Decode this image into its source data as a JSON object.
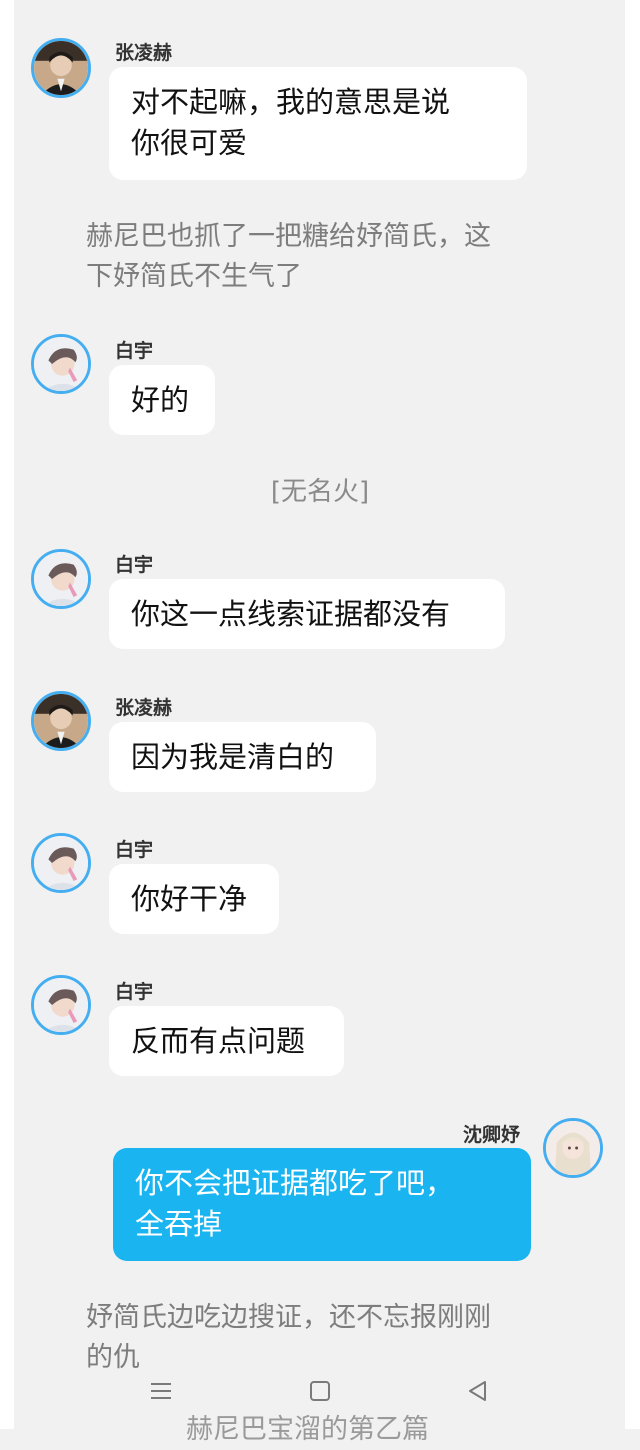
{
  "messages": [
    {
      "sender": "张凌赫",
      "lines": [
        "对不起嘛，我的意思是说",
        "你很可爱"
      ]
    },
    {
      "narration": [
        "赫尼巴也抓了一把糖给妤简氏，这",
        "下妤简氏不生气了"
      ]
    },
    {
      "sender": "白宇",
      "lines": [
        "好的"
      ]
    },
    {
      "system": "[无名火]"
    },
    {
      "sender": "白宇",
      "lines": [
        "你这一点线索证据都没有"
      ]
    },
    {
      "sender": "张凌赫",
      "lines": [
        "因为我是清白的"
      ]
    },
    {
      "sender": "白宇",
      "lines": [
        "你好干净"
      ]
    },
    {
      "sender": "白宇",
      "lines": [
        "反而有点问题"
      ]
    },
    {
      "sender": "沈卿妤",
      "lines": [
        "你不会把证据都吃了吧，",
        "全吞掉"
      ]
    },
    {
      "narration": [
        "妤简氏边吃边搜证，还不忘报刚刚",
        "的仇"
      ]
    }
  ],
  "cutoff_text": "赫尼巴宝溜的第乙篇",
  "navigation": {
    "menu_icon": "menu-icon",
    "home_icon": "home-square-icon",
    "back_icon": "back-triangle-icon"
  },
  "colors": {
    "background": "#f1f1f1",
    "bubble": "#ffffff",
    "my_bubble": "#1ab5f1",
    "avatar_ring": "#45aef0"
  }
}
